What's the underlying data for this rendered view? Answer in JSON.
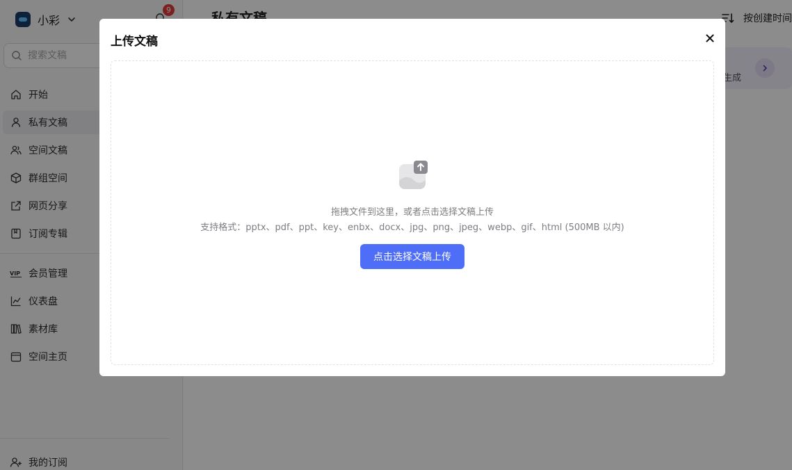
{
  "workspace": {
    "name": "小彩",
    "notification_count": "9"
  },
  "search": {
    "placeholder": "搜索文稿"
  },
  "nav": {
    "primary": [
      {
        "label": "开始",
        "icon": "home-icon"
      },
      {
        "label": "私有文稿",
        "icon": "user-icon",
        "active": true
      },
      {
        "label": "空间文稿",
        "icon": "users-icon"
      },
      {
        "label": "群组空间",
        "icon": "cube-icon"
      },
      {
        "label": "网页分享",
        "icon": "share-link-icon"
      },
      {
        "label": "订阅专辑",
        "icon": "bookmark-icon"
      }
    ],
    "secondary": [
      {
        "label": "会员管理",
        "icon": "vip-icon"
      },
      {
        "label": "仪表盘",
        "icon": "chart-icon"
      },
      {
        "label": "素材库",
        "icon": "library-icon"
      },
      {
        "label": "空间主页",
        "icon": "calendar-icon"
      }
    ],
    "bottom": [
      {
        "label": "我的订阅",
        "icon": "user-add-icon"
      }
    ]
  },
  "main": {
    "title": "私有文稿",
    "sort_label": "按创建时间",
    "card_hint_text": "生成"
  },
  "modal": {
    "title": "上传文稿",
    "dropzone_text": "拖拽文件到这里，或者点击选择文稿上传",
    "formats_text": "支持格式：pptx、pdf、ppt、key、enbx、docx、jpg、png、jpeg、webp、gif、html (500MB 以内)",
    "upload_button": "点击选择文稿上传"
  },
  "colors": {
    "primary": "#4f6ef7",
    "badge": "#e23a3a",
    "overlay": "rgba(0,0,0,0.45)"
  }
}
